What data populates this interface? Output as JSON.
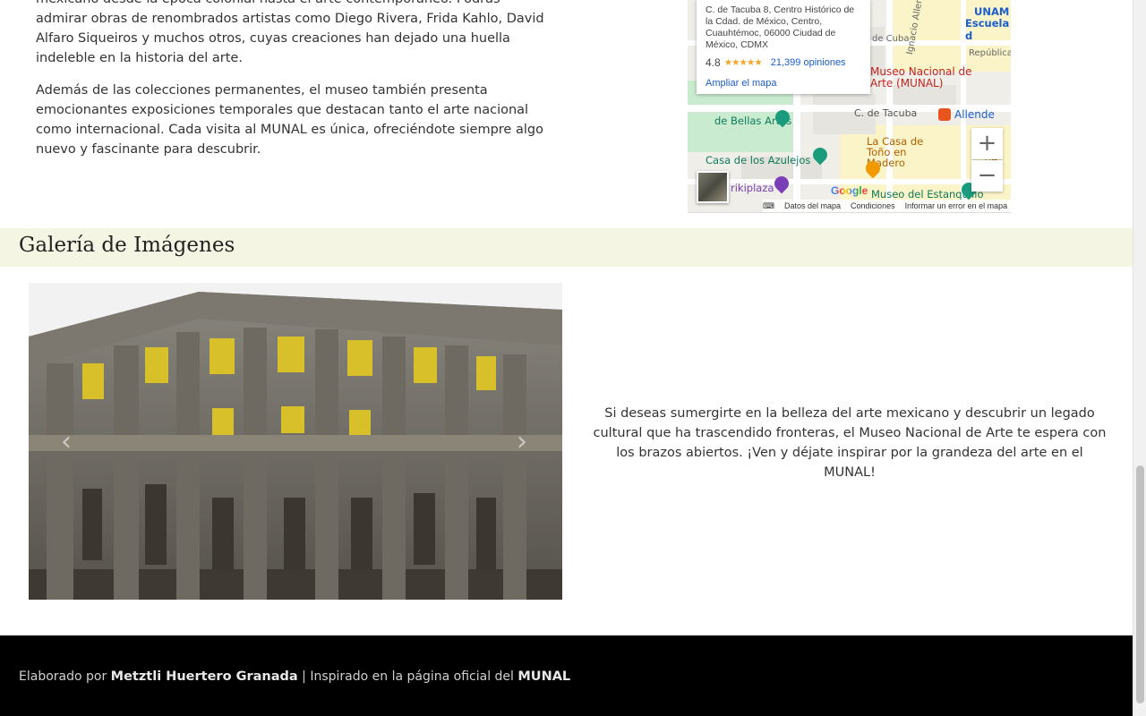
{
  "intro": {
    "paragraph1": "mexicano desde la época colonial hasta el arte contemporáneo. Podrás admirar obras de renombrados artistas como Diego Rivera, Frida Kahlo, David Alfaro Siqueiros y muchos otros, cuyas creaciones han dejado una huella indeleble en la historia del arte.",
    "paragraph2": "Además de las colecciones permanentes, el museo también presenta emocionantes exposiciones temporales que destacan tanto el arte nacional como internacional. Cada visita al MUNAL es única, ofreciéndote siempre algo nuevo y fascinante para descubrir."
  },
  "map": {
    "address": "C. de Tacuba 8, Centro Histórico de la Cdad. de México, Centro, Cuauhtémoc, 06000 Ciudad de México, CDMX",
    "rating": "4.8",
    "stars": "★★★★★",
    "reviews": "21,399 opiniones",
    "enlarge": "Ampliar el mapa",
    "labels": {
      "unam": "UNAM",
      "escuela": "Escuela d",
      "cuba": "de Cuba",
      "republica": "República",
      "ignacio": "Ignacio Allende",
      "munal": "Museo Nacional de Arte (MUNAL)",
      "bellas_artes": "de Bellas Artes",
      "tacuba": "C. de Tacuba",
      "allende": "Allende",
      "casa_tono": "La Casa de Toño en Madero",
      "azulejos": "Casa de los Azulejos",
      "frikiplaza": "rikiplaza",
      "estanquillo": "Museo del Estanquillo",
      "ca_de": "Ca de"
    },
    "zoom_in": "+",
    "zoom_out": "−",
    "google": "Google",
    "footer": {
      "keyboard": "⌨",
      "data": "Datos del mapa",
      "terms": "Condiciones",
      "report": "Informar un error en el mapa"
    }
  },
  "gallery": {
    "title": "Galería de Imágenes",
    "prev": "‹",
    "next": "›",
    "text": "Si deseas sumergirte en la belleza del arte mexicano y descubrir un legado cultural que ha trascendido fronteras, el Museo Nacional de Arte te espera con los brazos abiertos. ¡Ven y déjate inspirar por la grandeza del arte en el MUNAL!"
  },
  "footer": {
    "prefix": "Elaborado por ",
    "author": "Metztli Huertero Granada",
    "middle": " | Inspirado en la página oficial del ",
    "site": "MUNAL"
  },
  "colors": {
    "gallery_band": "#f5f5e3",
    "footer_bg": "#000000",
    "link_blue": "#1a5dcc",
    "star_orange": "#f4a62a",
    "munal_red": "#c5221f"
  }
}
